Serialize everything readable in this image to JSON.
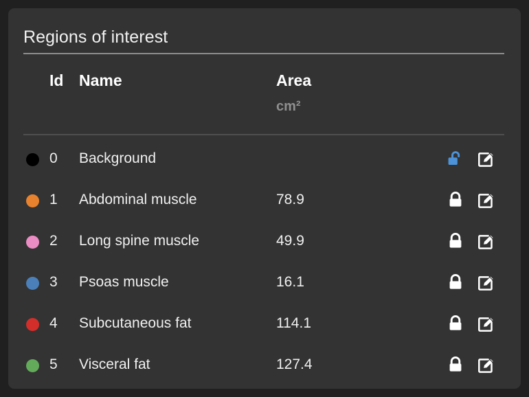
{
  "card": {
    "title": "Regions of interest"
  },
  "table": {
    "headers": {
      "color": "",
      "id": "Id",
      "name": "Name",
      "area": "Area",
      "area_unit": "cm²"
    },
    "rows": [
      {
        "color": "#000000",
        "id": "0",
        "name": "Background",
        "area": "",
        "lock_icon": "unlock-icon",
        "lock_state": "unlocked",
        "lock_color": "#4d93d9",
        "edit_icon": "edit-pencil-icon"
      },
      {
        "color": "#e8822e",
        "id": "1",
        "name": "Abdominal muscle",
        "area": "78.9",
        "lock_icon": "lock-icon",
        "lock_state": "locked",
        "lock_color": "#ffffff",
        "edit_icon": "edit-pencil-icon"
      },
      {
        "color": "#ec8cc4",
        "id": "2",
        "name": "Long spine muscle",
        "area": "49.9",
        "lock_icon": "lock-icon",
        "lock_state": "locked",
        "lock_color": "#ffffff",
        "edit_icon": "edit-pencil-icon"
      },
      {
        "color": "#4a7fba",
        "id": "3",
        "name": "Psoas muscle",
        "area": "16.1",
        "lock_icon": "lock-icon",
        "lock_state": "locked",
        "lock_color": "#ffffff",
        "edit_icon": "edit-pencil-icon"
      },
      {
        "color": "#d42e2a",
        "id": "4",
        "name": "Subcutaneous fat",
        "area": "114.1",
        "lock_icon": "lock-icon",
        "lock_state": "locked",
        "lock_color": "#ffffff",
        "edit_icon": "edit-pencil-icon"
      },
      {
        "color": "#63ab5b",
        "id": "5",
        "name": "Visceral fat",
        "area": "127.4",
        "lock_icon": "lock-icon",
        "lock_state": "locked",
        "lock_color": "#ffffff",
        "edit_icon": "edit-pencil-icon"
      }
    ]
  },
  "theme": {
    "page_background": "#202020",
    "card_background": "#333333",
    "text_primary": "#f0f0f0",
    "text_muted": "#8f8f8f",
    "accent_unlocked": "#4d93d9"
  }
}
